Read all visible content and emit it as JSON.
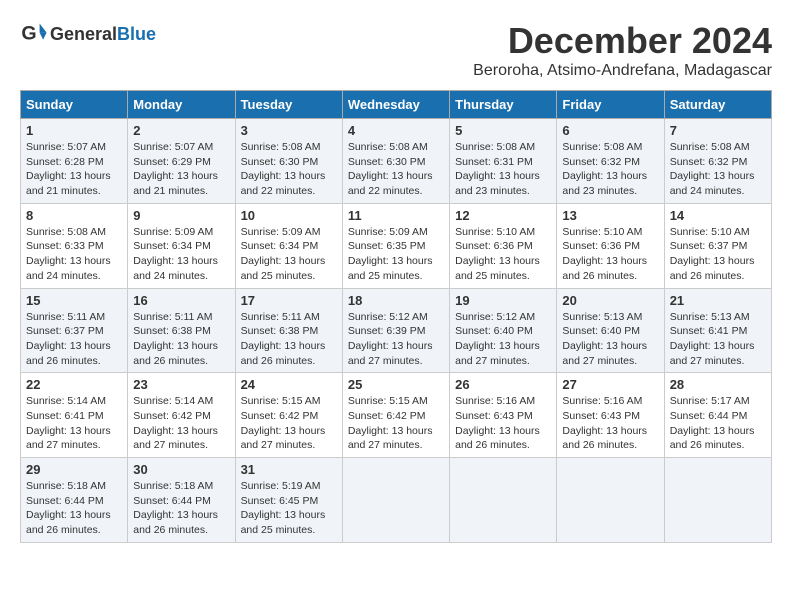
{
  "header": {
    "logo_general": "General",
    "logo_blue": "Blue",
    "month": "December 2024",
    "location": "Beroroha, Atsimo-Andrefana, Madagascar"
  },
  "days_of_week": [
    "Sunday",
    "Monday",
    "Tuesday",
    "Wednesday",
    "Thursday",
    "Friday",
    "Saturday"
  ],
  "weeks": [
    [
      {
        "day": "1",
        "lines": [
          "Sunrise: 5:07 AM",
          "Sunset: 6:28 PM",
          "Daylight: 13 hours",
          "and 21 minutes."
        ]
      },
      {
        "day": "2",
        "lines": [
          "Sunrise: 5:07 AM",
          "Sunset: 6:29 PM",
          "Daylight: 13 hours",
          "and 21 minutes."
        ]
      },
      {
        "day": "3",
        "lines": [
          "Sunrise: 5:08 AM",
          "Sunset: 6:30 PM",
          "Daylight: 13 hours",
          "and 22 minutes."
        ]
      },
      {
        "day": "4",
        "lines": [
          "Sunrise: 5:08 AM",
          "Sunset: 6:30 PM",
          "Daylight: 13 hours",
          "and 22 minutes."
        ]
      },
      {
        "day": "5",
        "lines": [
          "Sunrise: 5:08 AM",
          "Sunset: 6:31 PM",
          "Daylight: 13 hours",
          "and 23 minutes."
        ]
      },
      {
        "day": "6",
        "lines": [
          "Sunrise: 5:08 AM",
          "Sunset: 6:32 PM",
          "Daylight: 13 hours",
          "and 23 minutes."
        ]
      },
      {
        "day": "7",
        "lines": [
          "Sunrise: 5:08 AM",
          "Sunset: 6:32 PM",
          "Daylight: 13 hours",
          "and 24 minutes."
        ]
      }
    ],
    [
      {
        "day": "8",
        "lines": [
          "Sunrise: 5:08 AM",
          "Sunset: 6:33 PM",
          "Daylight: 13 hours",
          "and 24 minutes."
        ]
      },
      {
        "day": "9",
        "lines": [
          "Sunrise: 5:09 AM",
          "Sunset: 6:34 PM",
          "Daylight: 13 hours",
          "and 24 minutes."
        ]
      },
      {
        "day": "10",
        "lines": [
          "Sunrise: 5:09 AM",
          "Sunset: 6:34 PM",
          "Daylight: 13 hours",
          "and 25 minutes."
        ]
      },
      {
        "day": "11",
        "lines": [
          "Sunrise: 5:09 AM",
          "Sunset: 6:35 PM",
          "Daylight: 13 hours",
          "and 25 minutes."
        ]
      },
      {
        "day": "12",
        "lines": [
          "Sunrise: 5:10 AM",
          "Sunset: 6:36 PM",
          "Daylight: 13 hours",
          "and 25 minutes."
        ]
      },
      {
        "day": "13",
        "lines": [
          "Sunrise: 5:10 AM",
          "Sunset: 6:36 PM",
          "Daylight: 13 hours",
          "and 26 minutes."
        ]
      },
      {
        "day": "14",
        "lines": [
          "Sunrise: 5:10 AM",
          "Sunset: 6:37 PM",
          "Daylight: 13 hours",
          "and 26 minutes."
        ]
      }
    ],
    [
      {
        "day": "15",
        "lines": [
          "Sunrise: 5:11 AM",
          "Sunset: 6:37 PM",
          "Daylight: 13 hours",
          "and 26 minutes."
        ]
      },
      {
        "day": "16",
        "lines": [
          "Sunrise: 5:11 AM",
          "Sunset: 6:38 PM",
          "Daylight: 13 hours",
          "and 26 minutes."
        ]
      },
      {
        "day": "17",
        "lines": [
          "Sunrise: 5:11 AM",
          "Sunset: 6:38 PM",
          "Daylight: 13 hours",
          "and 26 minutes."
        ]
      },
      {
        "day": "18",
        "lines": [
          "Sunrise: 5:12 AM",
          "Sunset: 6:39 PM",
          "Daylight: 13 hours",
          "and 27 minutes."
        ]
      },
      {
        "day": "19",
        "lines": [
          "Sunrise: 5:12 AM",
          "Sunset: 6:40 PM",
          "Daylight: 13 hours",
          "and 27 minutes."
        ]
      },
      {
        "day": "20",
        "lines": [
          "Sunrise: 5:13 AM",
          "Sunset: 6:40 PM",
          "Daylight: 13 hours",
          "and 27 minutes."
        ]
      },
      {
        "day": "21",
        "lines": [
          "Sunrise: 5:13 AM",
          "Sunset: 6:41 PM",
          "Daylight: 13 hours",
          "and 27 minutes."
        ]
      }
    ],
    [
      {
        "day": "22",
        "lines": [
          "Sunrise: 5:14 AM",
          "Sunset: 6:41 PM",
          "Daylight: 13 hours",
          "and 27 minutes."
        ]
      },
      {
        "day": "23",
        "lines": [
          "Sunrise: 5:14 AM",
          "Sunset: 6:42 PM",
          "Daylight: 13 hours",
          "and 27 minutes."
        ]
      },
      {
        "day": "24",
        "lines": [
          "Sunrise: 5:15 AM",
          "Sunset: 6:42 PM",
          "Daylight: 13 hours",
          "and 27 minutes."
        ]
      },
      {
        "day": "25",
        "lines": [
          "Sunrise: 5:15 AM",
          "Sunset: 6:42 PM",
          "Daylight: 13 hours",
          "and 27 minutes."
        ]
      },
      {
        "day": "26",
        "lines": [
          "Sunrise: 5:16 AM",
          "Sunset: 6:43 PM",
          "Daylight: 13 hours",
          "and 26 minutes."
        ]
      },
      {
        "day": "27",
        "lines": [
          "Sunrise: 5:16 AM",
          "Sunset: 6:43 PM",
          "Daylight: 13 hours",
          "and 26 minutes."
        ]
      },
      {
        "day": "28",
        "lines": [
          "Sunrise: 5:17 AM",
          "Sunset: 6:44 PM",
          "Daylight: 13 hours",
          "and 26 minutes."
        ]
      }
    ],
    [
      {
        "day": "29",
        "lines": [
          "Sunrise: 5:18 AM",
          "Sunset: 6:44 PM",
          "Daylight: 13 hours",
          "and 26 minutes."
        ]
      },
      {
        "day": "30",
        "lines": [
          "Sunrise: 5:18 AM",
          "Sunset: 6:44 PM",
          "Daylight: 13 hours",
          "and 26 minutes."
        ]
      },
      {
        "day": "31",
        "lines": [
          "Sunrise: 5:19 AM",
          "Sunset: 6:45 PM",
          "Daylight: 13 hours",
          "and 25 minutes."
        ]
      },
      {
        "day": "",
        "lines": []
      },
      {
        "day": "",
        "lines": []
      },
      {
        "day": "",
        "lines": []
      },
      {
        "day": "",
        "lines": []
      }
    ]
  ]
}
